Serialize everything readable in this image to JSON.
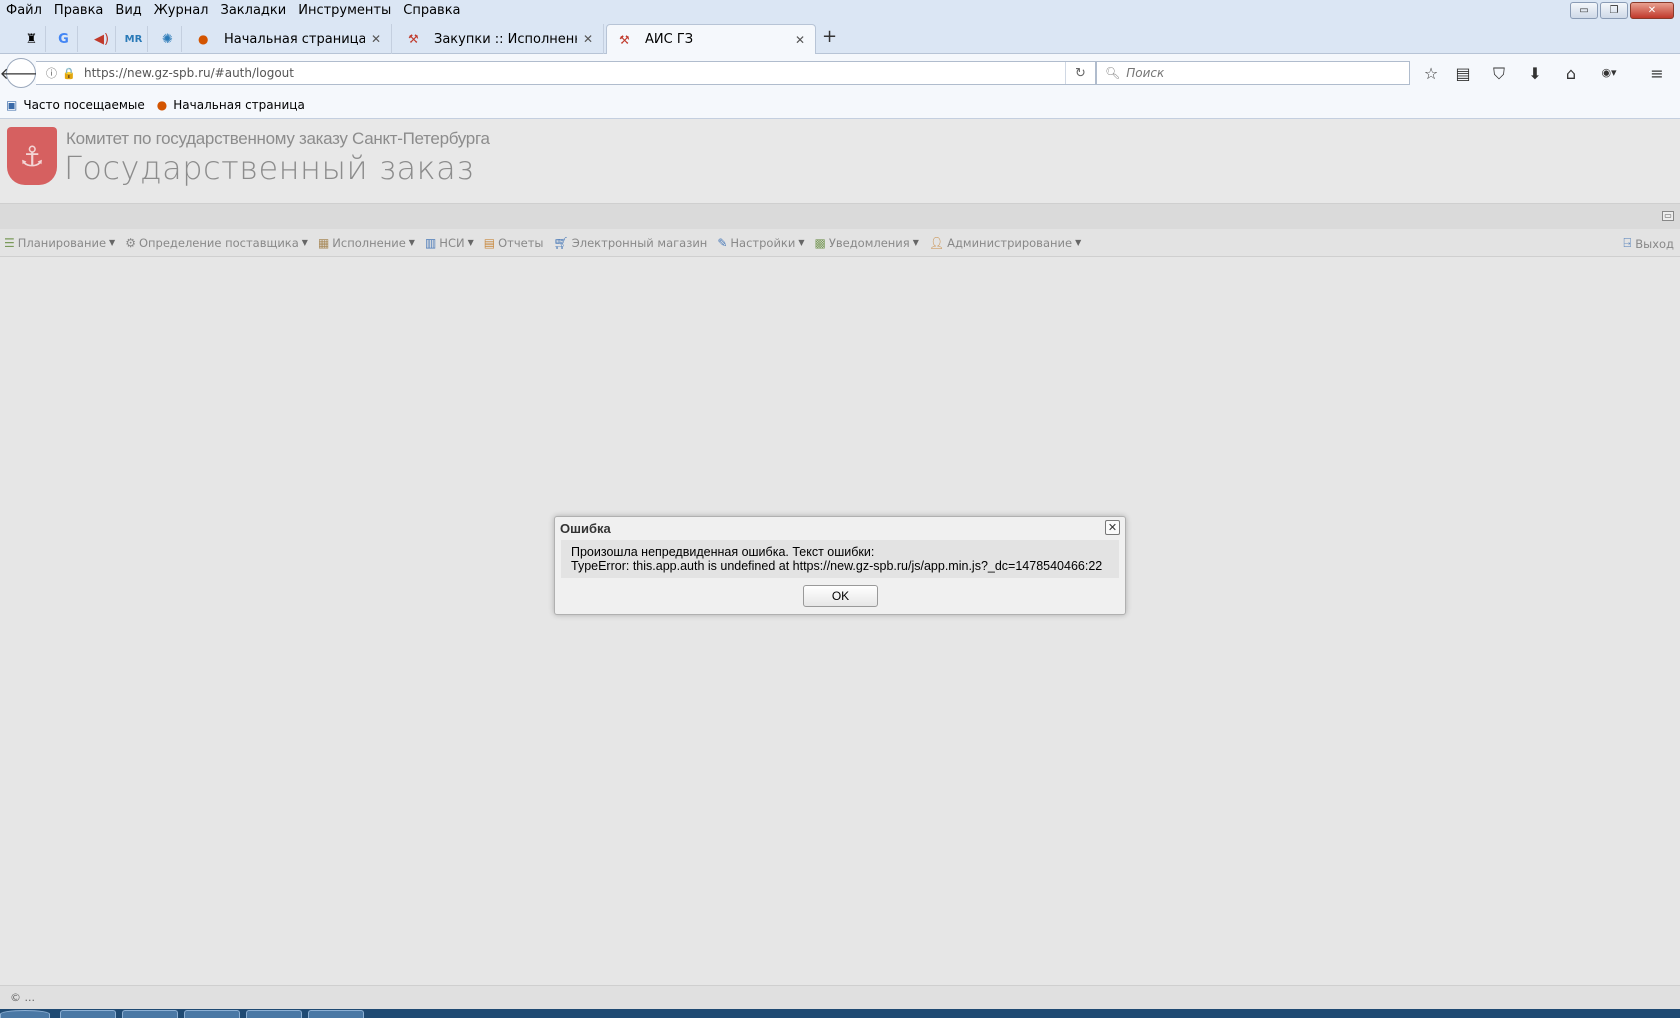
{
  "menubar": {
    "items": [
      "Файл",
      "Правка",
      "Вид",
      "Журнал",
      "Закладки",
      "Инструменты",
      "Справка"
    ]
  },
  "window_controls": {
    "minimize": "▭",
    "restore": "❐",
    "close": "✕"
  },
  "tabs": [
    {
      "label": "Начальная страница Mozi...",
      "icon": "firefox-icon",
      "active": false
    },
    {
      "label": "Закупки :: Исполненные ...",
      "icon": "gz-emblem-icon",
      "active": false
    },
    {
      "label": "АИС ГЗ",
      "icon": "gz-emblem-icon",
      "active": true
    }
  ],
  "newtab_label": "+",
  "navbar": {
    "url": "https://new.gz-spb.ru/#auth/logout",
    "search_placeholder": "Поиск"
  },
  "bookmarks": [
    {
      "label": "Часто посещаемые",
      "icon": "most-visited-icon"
    },
    {
      "label": "Начальная страница",
      "icon": "firefox-icon"
    }
  ],
  "header": {
    "subtitle": "Комитет по государственному заказу Санкт-Петербурга",
    "title": "Государственный заказ"
  },
  "app_menu": [
    {
      "label": "Планирование",
      "dropdown": true,
      "icon": "planning-icon"
    },
    {
      "label": "Определение поставщика",
      "dropdown": true,
      "icon": "gears-icon"
    },
    {
      "label": "Исполнение",
      "dropdown": true,
      "icon": "boxes-icon"
    },
    {
      "label": "НСИ",
      "dropdown": true,
      "icon": "book-icon"
    },
    {
      "label": "Отчеты",
      "dropdown": false,
      "icon": "report-icon"
    },
    {
      "label": "Электронный магазин",
      "dropdown": false,
      "icon": "cart-icon"
    },
    {
      "label": "Настройки",
      "dropdown": true,
      "icon": "wrench-icon"
    },
    {
      "label": "Уведомления",
      "dropdown": true,
      "icon": "notification-icon"
    },
    {
      "label": "Администрирование",
      "dropdown": true,
      "icon": "user-admin-icon"
    }
  ],
  "logout_label": "Выход",
  "dialog": {
    "title": "Ошибка",
    "line1": "Произошла непредвиденная ошибка. Текст ошибки:",
    "line2": "TypeError: this.app.auth is undefined at https://new.gz-spb.ru/js/app.min.js?_dc=1478540466:22",
    "ok_label": "OK"
  },
  "footer": {
    "text": "© ..."
  }
}
